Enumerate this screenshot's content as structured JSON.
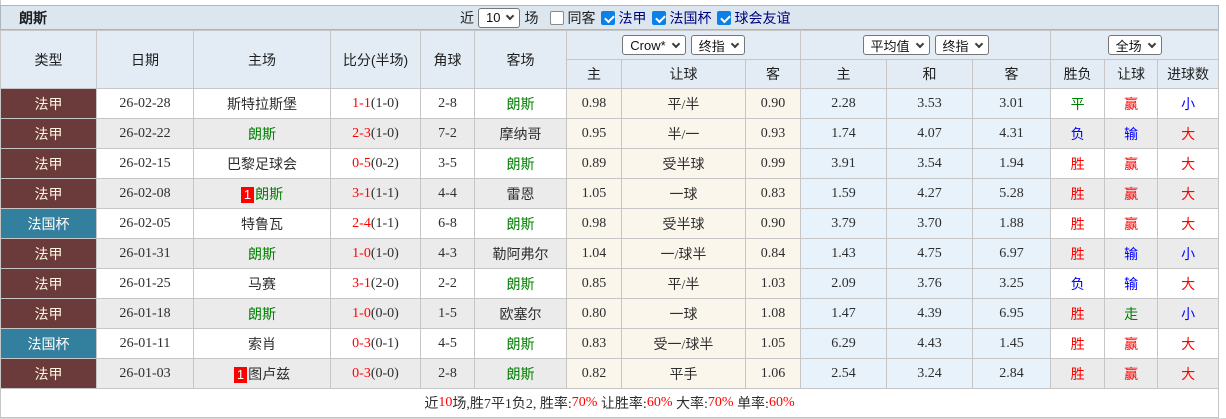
{
  "title": "朗斯",
  "toolbar": {
    "near_label": "近",
    "matches_select": "10",
    "matches_label": "场",
    "filters": [
      {
        "label": "同客",
        "checked": false,
        "color": "#1d1d1d"
      },
      {
        "label": "法甲",
        "checked": true,
        "color": "#000080"
      },
      {
        "label": "法国杯",
        "checked": true,
        "color": "#000080"
      },
      {
        "label": "球会友谊",
        "checked": true,
        "color": "#000080"
      }
    ]
  },
  "header": {
    "static_cols": [
      "类型",
      "日期",
      "主场",
      "比分(半场)",
      "角球",
      "客场"
    ],
    "crow_selects": [
      "Crow*",
      "终指"
    ],
    "avg_selects": [
      "平均值",
      "终指"
    ],
    "full_select": "全场",
    "crow_subcols": [
      "主",
      "让球",
      "客"
    ],
    "avg_subcols": [
      "主",
      "和",
      "客"
    ],
    "result_subcols": [
      "胜负",
      "让球",
      "进球数"
    ]
  },
  "colors": {
    "league_bg": "#6b3a3a",
    "cup_bg": "#337f9e",
    "win_red": "#ff0000",
    "lose_blue": "#0000ff",
    "draw_green": "#008000",
    "lens_green": "#008000",
    "titlebar_bg": "#dce6ef",
    "header_bg": "#e3ecf4",
    "row_alt_bg": "#ebebeb",
    "crow_col_bg": "#fbf6ec",
    "avg_col_bg": "#e7f2fa",
    "checkbox_blue": "#0d80e8"
  },
  "rows": [
    {
      "type": {
        "label": "法甲",
        "style": "league"
      },
      "date": "26-02-28",
      "home": {
        "name": "斯特拉斯堡",
        "lens": false,
        "badge": ""
      },
      "score": {
        "full": "1-1",
        "half": "(1-0)"
      },
      "corner": "2-8",
      "away": {
        "name": "朗斯",
        "lens": true,
        "badge": ""
      },
      "crow": {
        "home": "0.98",
        "handicap": "平/半",
        "away": "0.90"
      },
      "avg": {
        "home": "2.28",
        "draw": "3.53",
        "away": "3.01"
      },
      "result": {
        "outcome": {
          "text": "平",
          "color": "green"
        },
        "handicap": {
          "text": "赢",
          "color": "red"
        },
        "goals": {
          "text": "小",
          "color": "blue"
        }
      }
    },
    {
      "type": {
        "label": "法甲",
        "style": "league"
      },
      "date": "26-02-22",
      "home": {
        "name": "朗斯",
        "lens": true,
        "badge": ""
      },
      "score": {
        "full": "2-3",
        "half": "(1-0)"
      },
      "corner": "7-2",
      "away": {
        "name": "摩纳哥",
        "lens": false,
        "badge": ""
      },
      "crow": {
        "home": "0.95",
        "handicap": "半/一",
        "away": "0.93"
      },
      "avg": {
        "home": "1.74",
        "draw": "4.07",
        "away": "4.31"
      },
      "result": {
        "outcome": {
          "text": "负",
          "color": "blue"
        },
        "handicap": {
          "text": "输",
          "color": "blue"
        },
        "goals": {
          "text": "大",
          "color": "red"
        }
      }
    },
    {
      "type": {
        "label": "法甲",
        "style": "league"
      },
      "date": "26-02-15",
      "home": {
        "name": "巴黎足球会",
        "lens": false,
        "badge": ""
      },
      "score": {
        "full": "0-5",
        "half": "(0-2)"
      },
      "corner": "3-5",
      "away": {
        "name": "朗斯",
        "lens": true,
        "badge": ""
      },
      "crow": {
        "home": "0.89",
        "handicap": "受半球",
        "away": "0.99"
      },
      "avg": {
        "home": "3.91",
        "draw": "3.54",
        "away": "1.94"
      },
      "result": {
        "outcome": {
          "text": "胜",
          "color": "red"
        },
        "handicap": {
          "text": "赢",
          "color": "red"
        },
        "goals": {
          "text": "大",
          "color": "red"
        }
      }
    },
    {
      "type": {
        "label": "法甲",
        "style": "league"
      },
      "date": "26-02-08",
      "home": {
        "name": "朗斯",
        "lens": true,
        "badge": "1"
      },
      "score": {
        "full": "3-1",
        "half": "(1-1)"
      },
      "corner": "4-4",
      "away": {
        "name": "雷恩",
        "lens": false,
        "badge": ""
      },
      "crow": {
        "home": "1.05",
        "handicap": "一球",
        "away": "0.83"
      },
      "avg": {
        "home": "1.59",
        "draw": "4.27",
        "away": "5.28"
      },
      "result": {
        "outcome": {
          "text": "胜",
          "color": "red"
        },
        "handicap": {
          "text": "赢",
          "color": "red"
        },
        "goals": {
          "text": "大",
          "color": "red"
        }
      }
    },
    {
      "type": {
        "label": "法国杯",
        "style": "cup"
      },
      "date": "26-02-05",
      "home": {
        "name": "特鲁瓦",
        "lens": false,
        "badge": ""
      },
      "score": {
        "full": "2-4",
        "half": "(1-1)"
      },
      "corner": "6-8",
      "away": {
        "name": "朗斯",
        "lens": true,
        "badge": ""
      },
      "crow": {
        "home": "0.98",
        "handicap": "受半球",
        "away": "0.90"
      },
      "avg": {
        "home": "3.79",
        "draw": "3.70",
        "away": "1.88"
      },
      "result": {
        "outcome": {
          "text": "胜",
          "color": "red"
        },
        "handicap": {
          "text": "赢",
          "color": "red"
        },
        "goals": {
          "text": "大",
          "color": "red"
        }
      }
    },
    {
      "type": {
        "label": "法甲",
        "style": "league"
      },
      "date": "26-01-31",
      "home": {
        "name": "朗斯",
        "lens": true,
        "badge": ""
      },
      "score": {
        "full": "1-0",
        "half": "(1-0)"
      },
      "corner": "4-3",
      "away": {
        "name": "勒阿弗尔",
        "lens": false,
        "badge": ""
      },
      "crow": {
        "home": "1.04",
        "handicap": "一/球半",
        "away": "0.84"
      },
      "avg": {
        "home": "1.43",
        "draw": "4.75",
        "away": "6.97"
      },
      "result": {
        "outcome": {
          "text": "胜",
          "color": "red"
        },
        "handicap": {
          "text": "输",
          "color": "blue"
        },
        "goals": {
          "text": "小",
          "color": "blue"
        }
      }
    },
    {
      "type": {
        "label": "法甲",
        "style": "league"
      },
      "date": "26-01-25",
      "home": {
        "name": "马赛",
        "lens": false,
        "badge": ""
      },
      "score": {
        "full": "3-1",
        "half": "(2-0)"
      },
      "corner": "2-2",
      "away": {
        "name": "朗斯",
        "lens": true,
        "badge": ""
      },
      "crow": {
        "home": "0.85",
        "handicap": "平/半",
        "away": "1.03"
      },
      "avg": {
        "home": "2.09",
        "draw": "3.76",
        "away": "3.25"
      },
      "result": {
        "outcome": {
          "text": "负",
          "color": "blue"
        },
        "handicap": {
          "text": "输",
          "color": "blue"
        },
        "goals": {
          "text": "大",
          "color": "red"
        }
      }
    },
    {
      "type": {
        "label": "法甲",
        "style": "league"
      },
      "date": "26-01-18",
      "home": {
        "name": "朗斯",
        "lens": true,
        "badge": ""
      },
      "score": {
        "full": "1-0",
        "half": "(0-0)"
      },
      "corner": "1-5",
      "away": {
        "name": "欧塞尔",
        "lens": false,
        "badge": ""
      },
      "crow": {
        "home": "0.80",
        "handicap": "一球",
        "away": "1.08"
      },
      "avg": {
        "home": "1.47",
        "draw": "4.39",
        "away": "6.95"
      },
      "result": {
        "outcome": {
          "text": "胜",
          "color": "red"
        },
        "handicap": {
          "text": "走",
          "color": "green"
        },
        "goals": {
          "text": "小",
          "color": "blue"
        }
      }
    },
    {
      "type": {
        "label": "法国杯",
        "style": "cup"
      },
      "date": "26-01-11",
      "home": {
        "name": "索肖",
        "lens": false,
        "badge": ""
      },
      "score": {
        "full": "0-3",
        "half": "(0-1)"
      },
      "corner": "4-5",
      "away": {
        "name": "朗斯",
        "lens": true,
        "badge": ""
      },
      "crow": {
        "home": "0.83",
        "handicap": "受一/球半",
        "away": "1.05"
      },
      "avg": {
        "home": "6.29",
        "draw": "4.43",
        "away": "1.45"
      },
      "result": {
        "outcome": {
          "text": "胜",
          "color": "red"
        },
        "handicap": {
          "text": "赢",
          "color": "red"
        },
        "goals": {
          "text": "大",
          "color": "red"
        }
      }
    },
    {
      "type": {
        "label": "法甲",
        "style": "league"
      },
      "date": "26-01-03",
      "home": {
        "name": "图卢兹",
        "lens": false,
        "badge": "1"
      },
      "score": {
        "full": "0-3",
        "half": "(0-0)"
      },
      "corner": "2-8",
      "away": {
        "name": "朗斯",
        "lens": true,
        "badge": ""
      },
      "crow": {
        "home": "0.82",
        "handicap": "平手",
        "away": "1.06"
      },
      "avg": {
        "home": "2.54",
        "draw": "3.24",
        "away": "2.84"
      },
      "result": {
        "outcome": {
          "text": "胜",
          "color": "red"
        },
        "handicap": {
          "text": "赢",
          "color": "red"
        },
        "goals": {
          "text": "大",
          "color": "red"
        }
      }
    }
  ],
  "footer": {
    "segments": [
      {
        "text": "近",
        "color": "dark"
      },
      {
        "text": "10",
        "color": "red"
      },
      {
        "text": "场,胜7平1负2, 胜率:",
        "color": "dark"
      },
      {
        "text": "70%",
        "color": "red"
      },
      {
        "text": " 让胜率:",
        "color": "dark"
      },
      {
        "text": "60%",
        "color": "red"
      },
      {
        "text": " 大率:",
        "color": "dark"
      },
      {
        "text": "70%",
        "color": "red"
      },
      {
        "text": " 单率:",
        "color": "dark"
      },
      {
        "text": "60%",
        "color": "red"
      }
    ]
  }
}
